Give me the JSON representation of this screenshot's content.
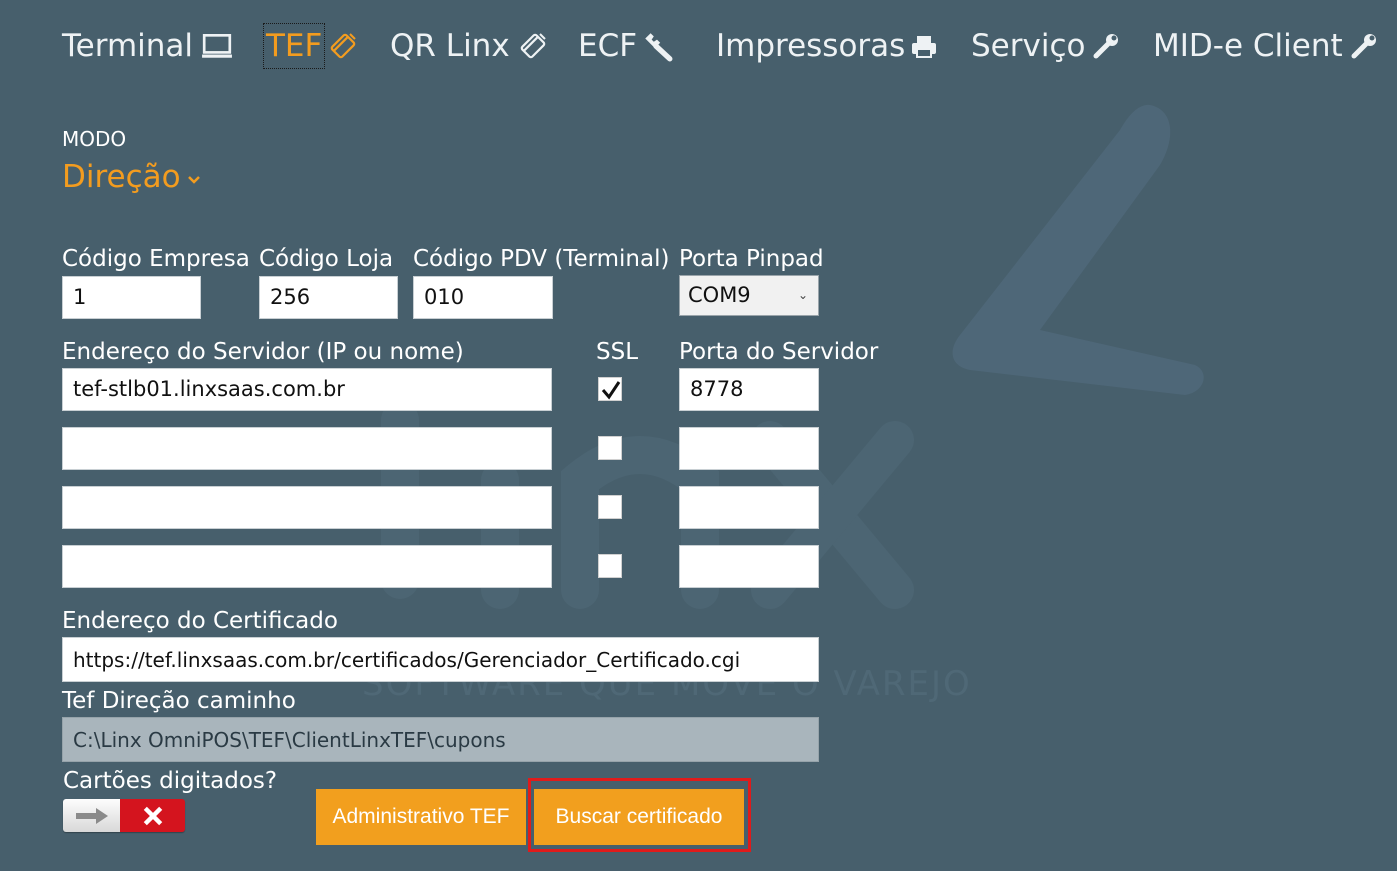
{
  "nav": {
    "items": [
      {
        "label": "Terminal",
        "icon": "monitor-icon"
      },
      {
        "label": "TEF",
        "icon": "card-swipe-icon",
        "active": true
      },
      {
        "label": "QR Linx",
        "icon": "card-swipe-icon"
      },
      {
        "label": "ECF",
        "icon": "wrench-icon"
      },
      {
        "label": "Impressoras",
        "icon": "printer-icon"
      },
      {
        "label": "Serviço",
        "icon": "wrench-icon"
      },
      {
        "label": "MID-e Client",
        "icon": "wrench-icon"
      }
    ]
  },
  "mode": {
    "caption": "MODO",
    "value": "Direção"
  },
  "form": {
    "codigo_empresa": {
      "label": "Código Empresa",
      "value": "1"
    },
    "codigo_loja": {
      "label": "Código Loja",
      "value": "256"
    },
    "codigo_pdv": {
      "label": "Código PDV (Terminal)",
      "value": "010"
    },
    "porta_pinpad": {
      "label": "Porta Pinpad",
      "value": "COM9"
    },
    "servidor_label": "Endereço do Servidor (IP ou nome)",
    "ssl_label": "SSL",
    "porta_servidor_label": "Porta do Servidor",
    "servers": [
      {
        "address": "tef-stlb01.linxsaas.com.br",
        "ssl": true,
        "port": "8778"
      },
      {
        "address": "",
        "ssl": false,
        "port": ""
      },
      {
        "address": "",
        "ssl": false,
        "port": ""
      },
      {
        "address": "",
        "ssl": false,
        "port": ""
      }
    ],
    "certificado": {
      "label": "Endereço do Certificado",
      "value": "https://tef.linxsaas.com.br/certificados/Gerenciador_Certificado.cgi"
    },
    "caminho": {
      "label": "Tef Direção caminho",
      "value": "C:\\Linx OmniPOS\\TEF\\ClientLinxTEF\\cupons"
    },
    "cartoes": {
      "label": "Cartões digitados?",
      "enabled": false
    }
  },
  "buttons": {
    "admin": "Administrativo TEF",
    "buscar": "Buscar certificado"
  },
  "colors": {
    "background": "#475f6c",
    "accent": "#f29f1e",
    "highlight": "#e01b1b"
  }
}
